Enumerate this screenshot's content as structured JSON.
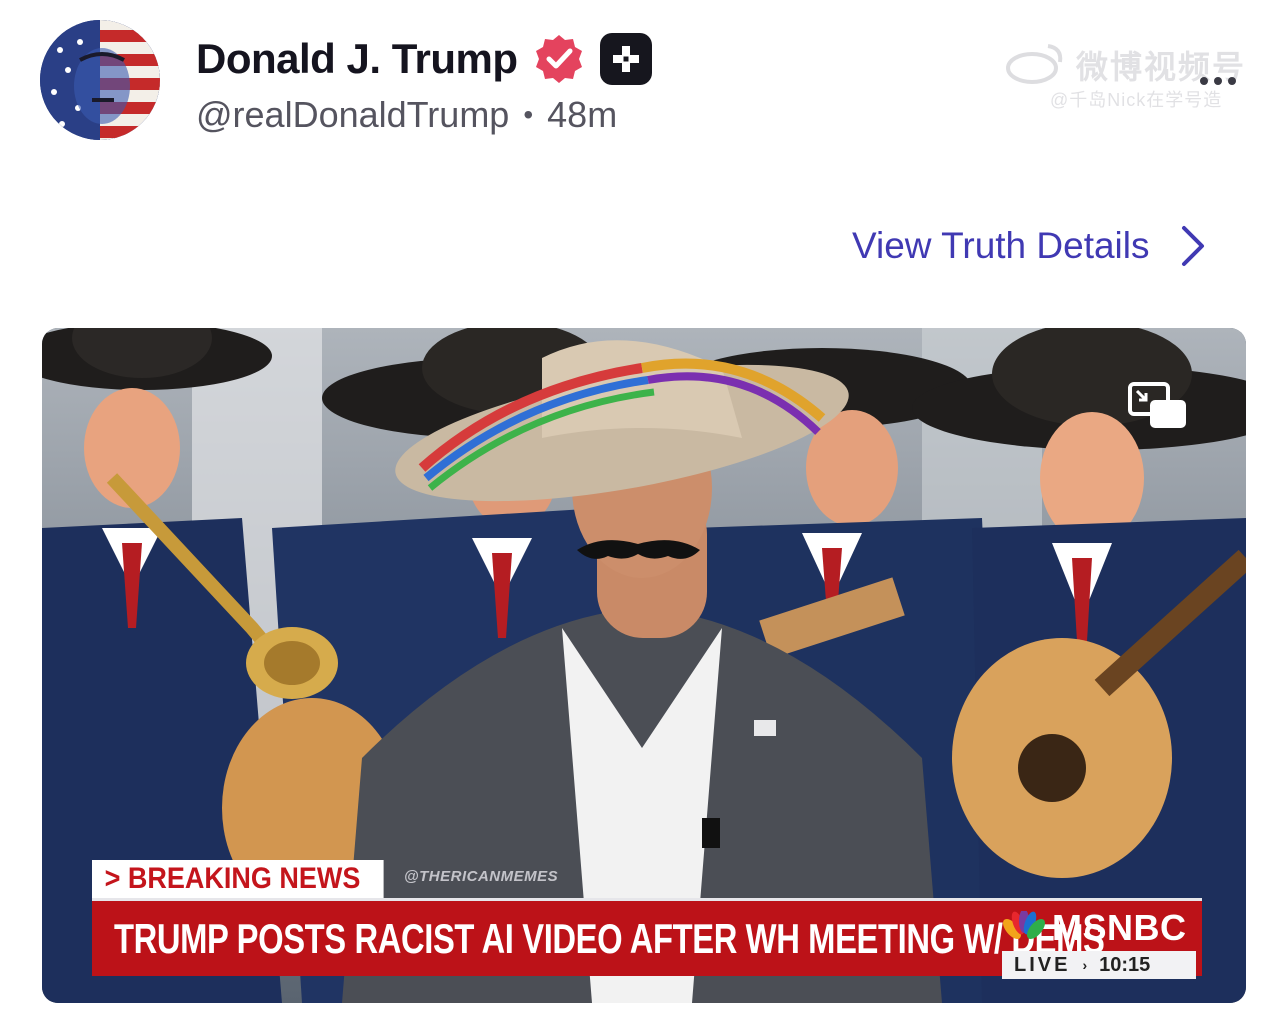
{
  "author": {
    "display_name": "Donald J. Trump",
    "handle": "@realDonaldTrump",
    "separator": "•",
    "age": "48m",
    "verified_icon": "verified-badge-icon",
    "badge_icon": "plus-badge-icon"
  },
  "watermark": {
    "text": "微博视频号",
    "sub": "@千岛Nick在学号造"
  },
  "actions": {
    "view_details_label": "View Truth Details",
    "more_icon": "more-dots-icon",
    "chevron_icon": "chevron-right-icon"
  },
  "video": {
    "pip_icon": "picture-in-picture-icon",
    "chyron": {
      "tag": "> BREAKING NEWS",
      "credit": "@THERICANMEMES",
      "headline": "TRUMP POSTS RACIST AI VIDEO AFTER WH MEETING W/ DEMS",
      "network": "MSNBC",
      "live": "LIVE",
      "time": "10:15"
    }
  },
  "colors": {
    "link": "#4039b3",
    "verified": "#e4435e",
    "chyron_red": "#bc1218"
  }
}
